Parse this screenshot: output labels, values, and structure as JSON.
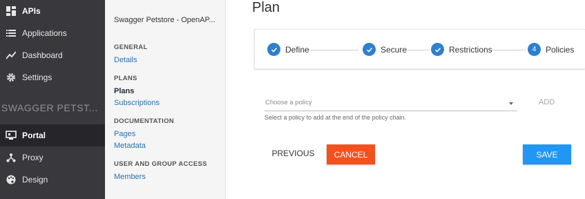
{
  "sidebar": {
    "apis_label": "APIs",
    "applications_label": "Applications",
    "dashboard_label": "Dashboard",
    "settings_label": "Settings",
    "api_name": "SWAGGER PETST...",
    "portal_label": "Portal",
    "proxy_label": "Proxy",
    "design_label": "Design"
  },
  "submenu": {
    "api_title": "Swagger Petstore - OpenAP...",
    "general_heading": "GENERAL",
    "details_link": "Details",
    "plans_heading": "PLANS",
    "plans_link": "Plans",
    "subscriptions_link": "Subscriptions",
    "documentation_heading": "DOCUMENTATION",
    "pages_link": "Pages",
    "metadata_link": "Metadata",
    "user_group_heading": "USER AND GROUP ACCESS",
    "members_link": "Members"
  },
  "main": {
    "title": "Plan",
    "steps": [
      {
        "label": "Define",
        "status": "done"
      },
      {
        "label": "Secure",
        "status": "done"
      },
      {
        "label": "Restrictions",
        "status": "done"
      },
      {
        "label": "Policies",
        "number": "4",
        "status": "current"
      }
    ],
    "policy_placeholder": "Choose a policy",
    "policy_hint": "Select a policy to add at the end of the policy chain.",
    "add_label": "ADD",
    "previous_label": "PREVIOUS",
    "cancel_label": "CANCEL",
    "save_label": "SAVE"
  },
  "colors": {
    "sidebar_bg": "#39393d",
    "step_accent": "#2f7fcf",
    "cancel_bg": "#f4511e",
    "save_bg": "#2196f3",
    "link": "#2c6fb0"
  },
  "icons": {
    "apis": "dashboard-grid-icon",
    "applications": "list-icon",
    "dashboard": "trend-line-icon",
    "settings": "gear-icon",
    "portal": "monitor-icon",
    "proxy": "fork-icon",
    "design": "palette-icon",
    "step_done": "check-icon",
    "select": "caret-down-icon"
  }
}
